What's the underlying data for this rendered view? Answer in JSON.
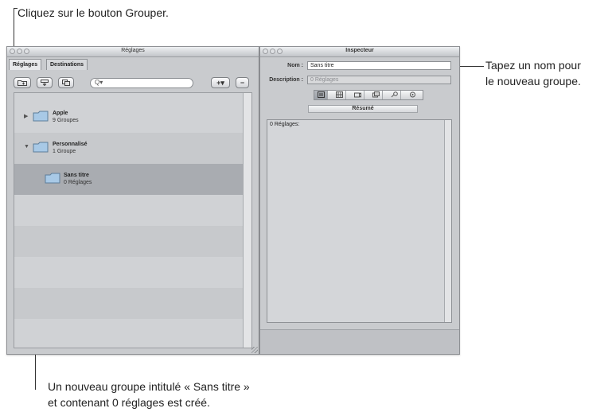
{
  "callouts": {
    "top": "Cliquez sur le bouton Grouper.",
    "right_line1": "Tapez un nom pour",
    "right_line2": "le nouveau groupe.",
    "bottom_line1": "Un nouveau groupe intitulé « Sans titre »",
    "bottom_line2": "et contenant 0 réglages est créé."
  },
  "settings_window": {
    "title": "Réglages",
    "tabs": [
      {
        "label": "Réglages",
        "active": true
      },
      {
        "label": "Destinations",
        "active": false
      }
    ],
    "toolbar": {
      "group_icon": "folder-add-icon",
      "export_icon": "export-icon",
      "duplicate_icon": "duplicate-icon",
      "search_placeholder": "Q▾",
      "add_label": "+▾",
      "remove_label": "−"
    },
    "rows": [
      {
        "name": "Apple",
        "sub": "9 Groupes",
        "disclosure": "▶"
      },
      {
        "name": "Personnalisé",
        "sub": "1 Groupe",
        "disclosure": "▼"
      },
      {
        "name": "Sans titre",
        "sub": "0 Réglages",
        "disclosure": ""
      }
    ]
  },
  "inspector_window": {
    "title": "Inspecteur",
    "name_label": "Nom :",
    "name_value": "Sans titre",
    "description_label": "Description :",
    "description_value": "0 Réglages",
    "summary_button": "Résumé",
    "content_text": "0 Réglages:",
    "tool_icons": [
      "summary-icon",
      "grid-icon",
      "video-icon",
      "filters-icon",
      "geometry-icon",
      "actions-icon"
    ]
  }
}
